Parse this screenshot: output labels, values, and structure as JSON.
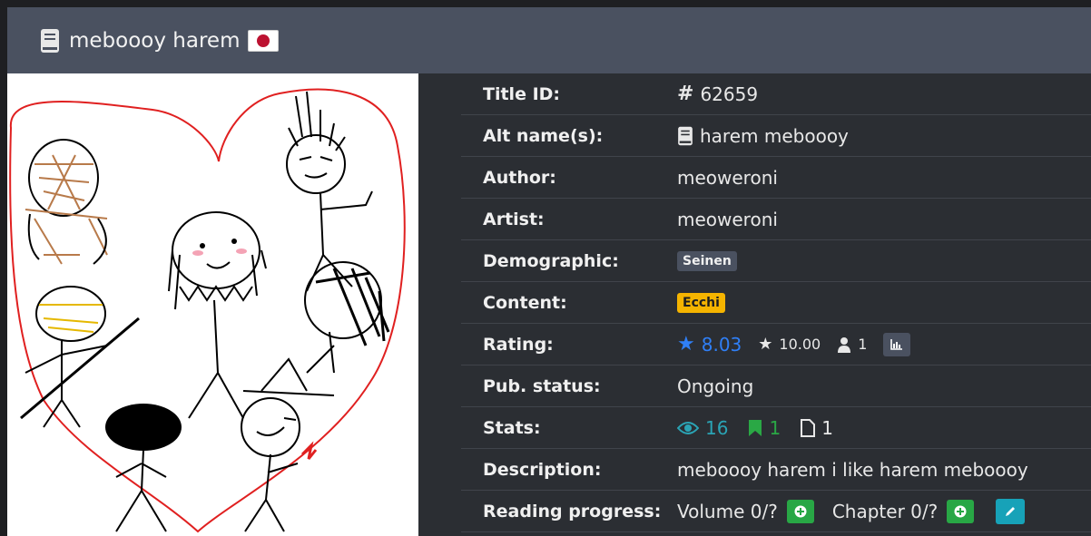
{
  "header": {
    "title": "meboooy harem",
    "flag_icon": "flag-jp-icon",
    "book_icon": "book-icon"
  },
  "cover": {
    "alt": "cover image drawing of stick figures inside a red heart"
  },
  "fields": {
    "title_id_label": "Title ID:",
    "title_id_value": "62659",
    "alt_names_label": "Alt name(s):",
    "alt_names_value": "harem meboooy",
    "author_label": "Author:",
    "author_value": "meoweroni",
    "artist_label": "Artist:",
    "artist_value": "meoweroni",
    "demographic_label": "Demographic:",
    "demographic_value": "Seinen",
    "content_label": "Content:",
    "content_value": "Ecchi",
    "rating_label": "Rating:",
    "rating_bayesian": "8.03",
    "rating_mean": "10.00",
    "rating_users": "1",
    "pub_status_label": "Pub. status:",
    "pub_status_value": "Ongoing",
    "stats_label": "Stats:",
    "stats_views": "16",
    "stats_follows": "1",
    "stats_comments": "1",
    "description_label": "Description:",
    "description_value": "meboooy harem i like harem meboooy",
    "reading_progress_label": "Reading progress:",
    "volume_value": "Volume 0/?",
    "chapter_value": "Chapter 0/?"
  },
  "colors": {
    "header_bg": "#4a5160",
    "body_bg": "#2b2e33",
    "accent_blue": "#2f7ff6",
    "accent_teal": "#2aa4b5",
    "accent_green": "#28a745",
    "ecchi_badge": "#f5b400"
  }
}
